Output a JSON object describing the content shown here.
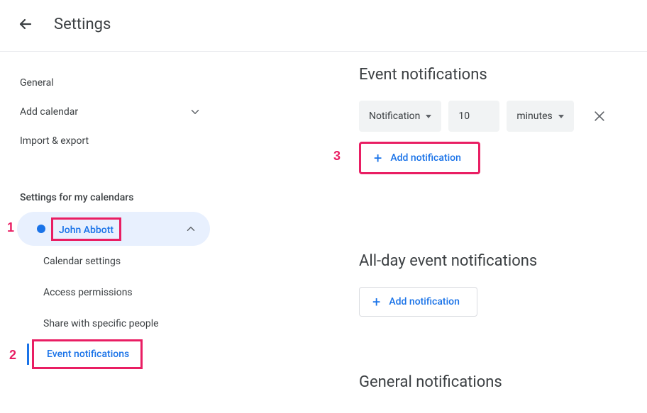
{
  "header": {
    "title": "Settings"
  },
  "sidebar": {
    "items": [
      {
        "label": "General"
      },
      {
        "label": "Add calendar"
      },
      {
        "label": "Import & export"
      }
    ],
    "section_heading": "Settings for my calendars",
    "calendar": {
      "name": "John Abbott",
      "color": "#1a73e8"
    },
    "sub_items": [
      {
        "label": "Calendar settings"
      },
      {
        "label": "Access permissions"
      },
      {
        "label": "Share with specific people"
      },
      {
        "label": "Event notifications"
      }
    ]
  },
  "main": {
    "event_notifications": {
      "title": "Event notifications",
      "row": {
        "type": "Notification",
        "value": "10",
        "unit": "minutes"
      },
      "add_label": "Add notification"
    },
    "allday": {
      "title": "All-day event notifications",
      "add_label": "Add notification"
    },
    "general": {
      "title": "General notifications"
    }
  },
  "callouts": {
    "c1": "1",
    "c2": "2",
    "c3": "3"
  }
}
